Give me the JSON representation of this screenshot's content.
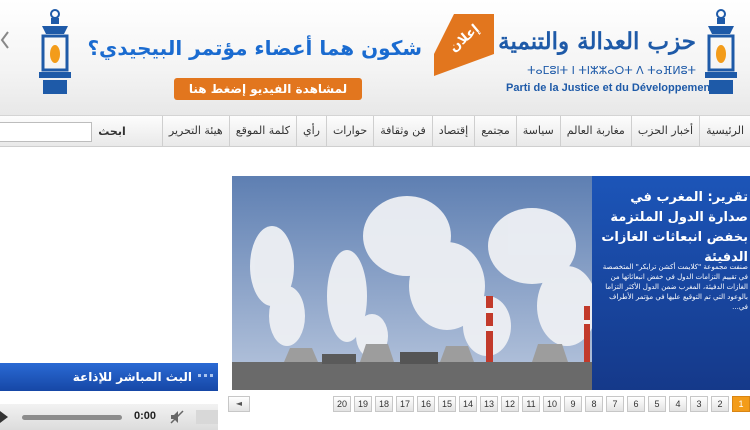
{
  "header": {
    "party_name_ar": "حزب العدالة والتنمية",
    "party_name_amazigh": "ⵜⴰⵎⵓⵏⵜ ⵏ ⵜⵏⵣⵣⴰⵔⵜ ⴷ ⵜⴰⴼⵍⵓⵜ",
    "party_name_fr": "Parti de la Justice et du Développement",
    "ad_label": "إعلان",
    "banner_headline": "شكون هما أعضاء مؤتمر البيجيدي؟",
    "watch_video_label": "لمشاهدة الفيديو إضغط هنا"
  },
  "nav": {
    "items": [
      "الرئيسية",
      "أخبار الحزب",
      "مغاربة العالم",
      "سياسة",
      "مجتمع",
      "إقتصاد",
      "فن وثقافة",
      "حوارات",
      "رأي",
      "كلمة الموقع",
      "هيئة التحرير"
    ],
    "search_label": "ابحث",
    "search_value": ""
  },
  "slider": {
    "title": "تقرير: المغرب في صدارة الدول الملتزمة بخفض انبعاثات الغازات الدفيئة",
    "excerpt": "صنفت مجموعة \"كلايمت أكشن ترايكر\" المتخصصة في تقييم التزامات الدول في خفض انبعاثاتها من الغازات الدفيئة، المغرب ضمن الدول الأكثر التزاما بالوعود التي تم التوقيع عليها في مؤتمر الأطراف في...",
    "pages": [
      "1",
      "2",
      "3",
      "4",
      "5",
      "6",
      "7",
      "8",
      "9",
      "10",
      "11",
      "12",
      "13",
      "14",
      "15",
      "16",
      "17",
      "18",
      "19",
      "20"
    ],
    "active_page": "1",
    "prev_symbol": "◄"
  },
  "radio": {
    "title": "البث المباشر للإذاعة",
    "time": "0:00"
  },
  "colors": {
    "brand_blue": "#1e5aa8",
    "accent_orange": "#e2761e",
    "slider_blue": "#1c55b8"
  }
}
